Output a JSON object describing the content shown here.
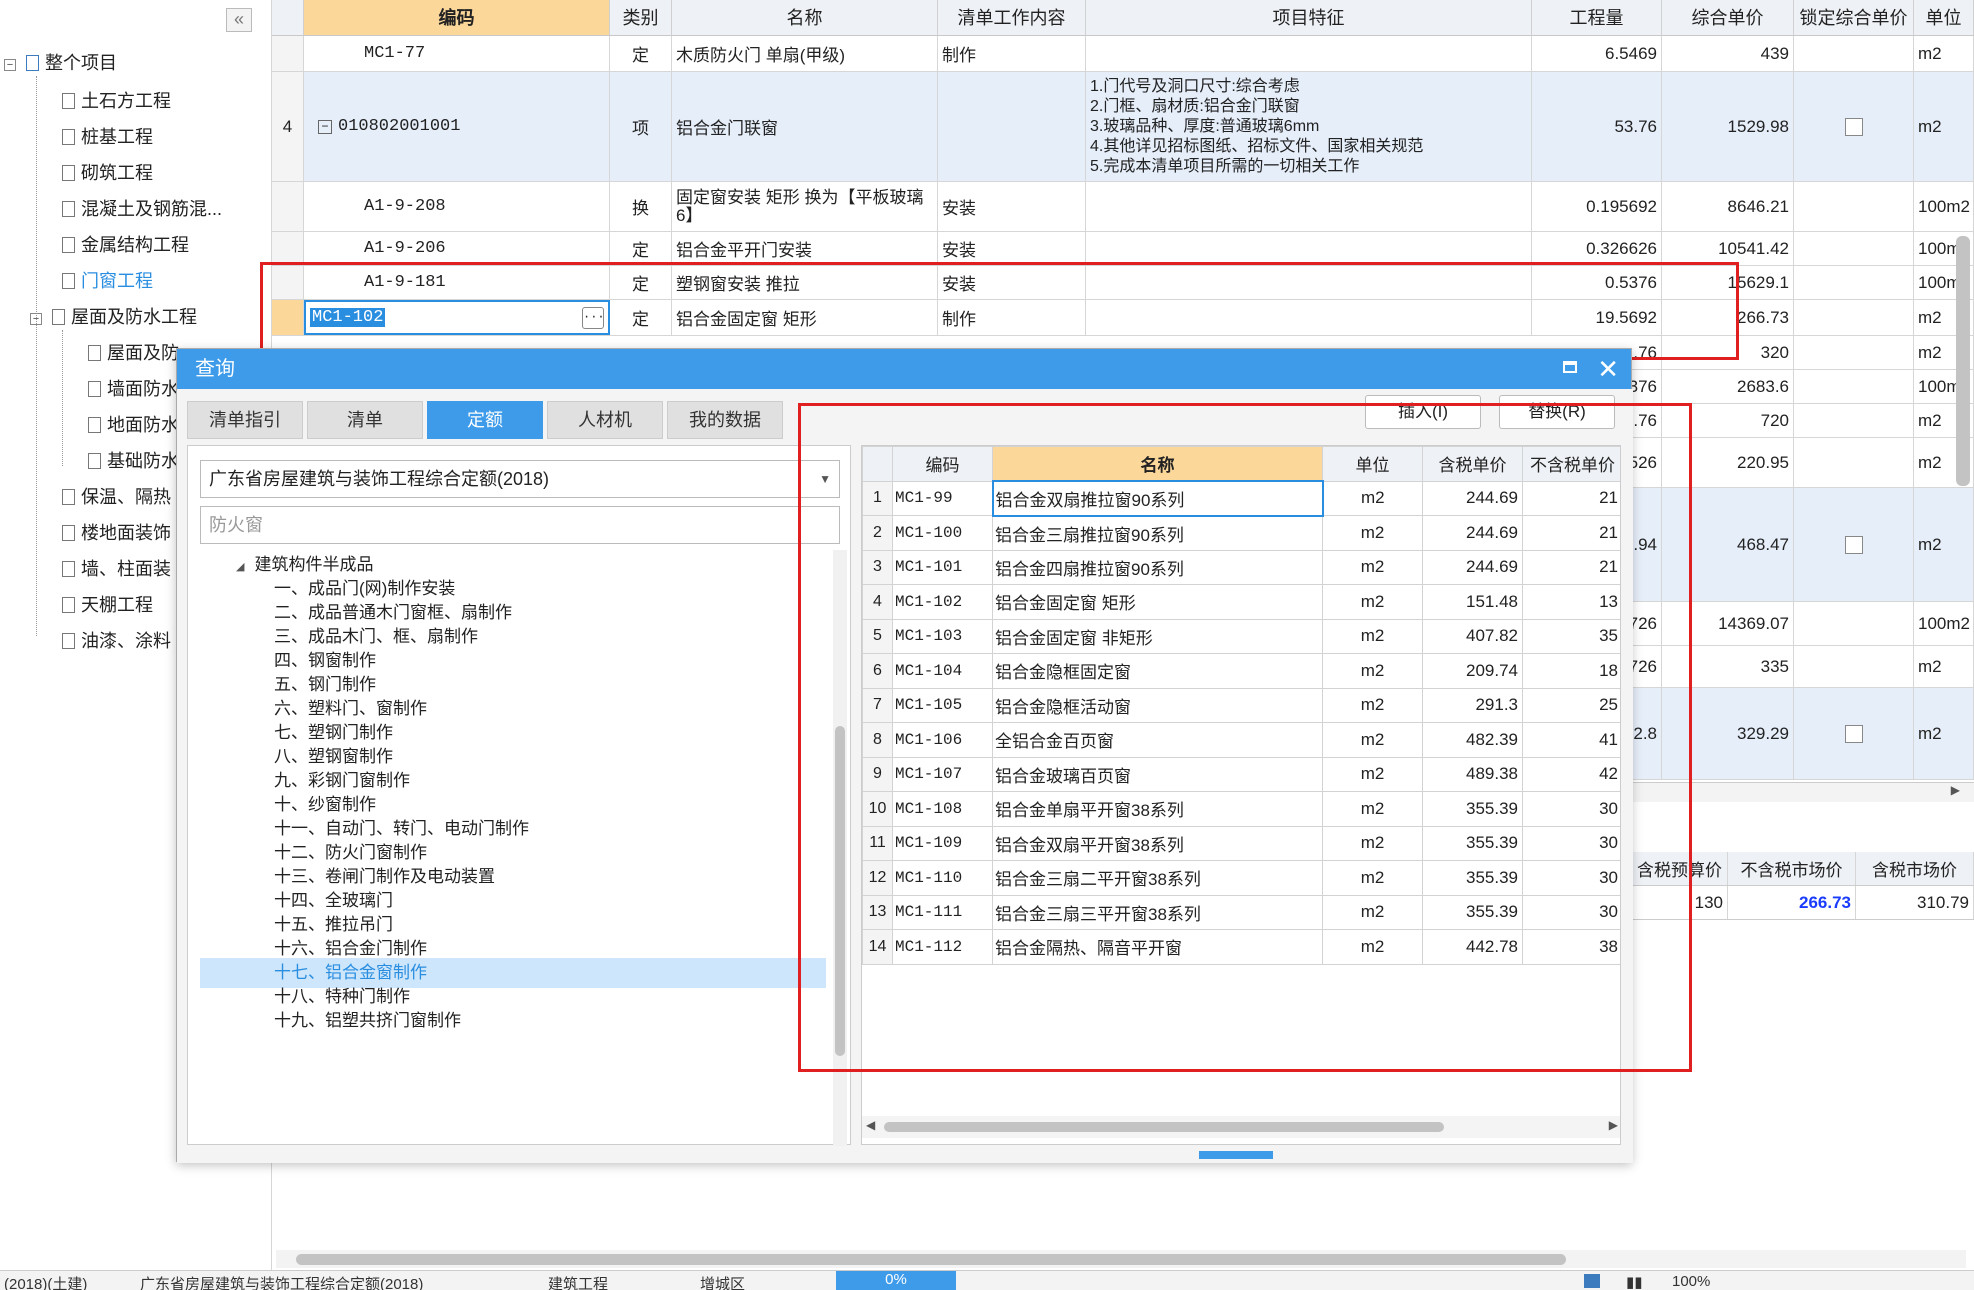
{
  "left_tree": {
    "items": [
      {
        "label": "整个项目"
      },
      {
        "label": "土石方工程"
      },
      {
        "label": "桩基工程"
      },
      {
        "label": "砌筑工程"
      },
      {
        "label": "混凝土及钢筋混..."
      },
      {
        "label": "金属结构工程"
      },
      {
        "label": "门窗工程"
      },
      {
        "label": "屋面及防水工程"
      },
      {
        "label": "屋面及防"
      },
      {
        "label": "墙面防水"
      },
      {
        "label": "地面防水"
      },
      {
        "label": "基础防水"
      },
      {
        "label": "保温、隔热"
      },
      {
        "label": "楼地面装饰"
      },
      {
        "label": "墙、柱面装"
      },
      {
        "label": "天棚工程"
      },
      {
        "label": "油漆、涂料"
      }
    ]
  },
  "grid": {
    "headers": [
      "编码",
      "类别",
      "名称",
      "清单工作内容",
      "项目特征",
      "工程量",
      "综合单价",
      "锁定综合单价",
      "单位"
    ],
    "rows": [
      {
        "no": "",
        "code": "MC1-77",
        "type": "定",
        "name": "木质防火门 单扇(甲级)",
        "work": "制作",
        "feature": "",
        "qty": "6.5469",
        "price": "439",
        "unit": "m2"
      },
      {
        "no": "4",
        "code": "010802001001",
        "type": "项",
        "name": "铝合金门联窗",
        "work": "",
        "feature_lines": [
          "1.门代号及洞口尺寸:综合考虑",
          "2.门框、扇材质:铝合金门联窗",
          "3.玻璃品种、厚度:普通玻璃6mm",
          "4.其他详见招标图纸、招标文件、国家相关规范",
          "5.完成本清单项目所需的一切相关工作"
        ],
        "qty": "53.76",
        "price": "1529.98",
        "unit": "m2"
      },
      {
        "no": "",
        "code": "A1-9-208",
        "type": "换",
        "name": "固定窗安装 矩形  换为【平板玻璃6】",
        "work": "安装",
        "feature": "",
        "qty": "0.195692",
        "price": "8646.21",
        "unit": "100m2"
      },
      {
        "no": "",
        "code": "A1-9-206",
        "type": "定",
        "name": "铝合金平开门安装",
        "work": "安装",
        "feature": "",
        "qty": "0.326626",
        "price": "10541.42",
        "unit": "100m2"
      },
      {
        "no": "",
        "code": "A1-9-181",
        "type": "定",
        "name": "塑钢窗安装 推拉",
        "work": "安装",
        "feature": "",
        "qty": "0.5376",
        "price": "15629.1",
        "unit": "100m2"
      },
      {
        "no": "",
        "code": "MC1-102",
        "type": "定",
        "name": "铝合金固定窗 矩形",
        "work": "制作",
        "feature": "",
        "qty": "19.5692",
        "price": "266.73",
        "unit": "m2"
      }
    ],
    "partial_right_rows": [
      {
        "qty": ".76",
        "price": "320",
        "unit": "m2"
      },
      {
        "qty": ".376",
        "price": "2683.6",
        "unit": "100m2"
      },
      {
        "qty": ".76",
        "price": "720",
        "unit": "m2"
      },
      {
        "qty": ".526",
        "price": "220.95",
        "unit": "m2"
      },
      {
        "qty": ".94",
        "price": "468.47",
        "unit": "m2"
      },
      {
        "qty": ".726",
        "price": "14369.07",
        "unit": "100m2"
      },
      {
        "qty": ".726",
        "price": "335",
        "unit": "m2"
      },
      {
        "qty": "2.8",
        "price": "329.29",
        "unit": "m2"
      }
    ],
    "bottom_headers": [
      "含税预算价",
      "不含税市场价",
      "含税市场价"
    ],
    "bottom_values": [
      "130",
      "266.73",
      "310.79"
    ]
  },
  "status_bar": {
    "items": [
      "(2018)(土建)",
      "广东省房屋建筑与装饰工程综合定额(2018)",
      "建筑工程",
      "增城区",
      "0%",
      "100%"
    ]
  },
  "dialog": {
    "title": "查询",
    "tabs": [
      "清单指引",
      "清单",
      "定额",
      "人材机",
      "我的数据"
    ],
    "active_tab": "定额",
    "library": "广东省房屋建筑与装饰工程综合定额(2018)",
    "search_placeholder": "防火窗",
    "tree_root": "建筑构件半成品",
    "chapters": [
      "一、成品门(网)制作安装",
      "二、成品普通木门窗框、扇制作",
      "三、成品木门、框、扇制作",
      "四、钢窗制作",
      "五、钢门制作",
      "六、塑料门、窗制作",
      "七、塑钢门制作",
      "八、塑钢窗制作",
      "九、彩钢门窗制作",
      "十、纱窗制作",
      "十一、自动门、转门、电动门制作",
      "十二、防火门窗制作",
      "十三、卷闸门制作及电动装置",
      "十四、全玻璃门",
      "十五、推拉吊门",
      "十六、铝合金门制作",
      "十七、铝合金窗制作",
      "十八、特种门制作",
      "十九、铝塑共挤门窗制作"
    ],
    "selected_chapter": "十七、铝合金窗制作",
    "insert_label": "插入(I)",
    "replace_label": "替换(R)",
    "table_headers": [
      "编码",
      "名称",
      "单位",
      "含税单价",
      "不含税单价"
    ],
    "rows": [
      {
        "idx": "1",
        "code": "MC1-99",
        "name": "铝合金双扇推拉窗90系列",
        "unit": "m2",
        "tax_price": "244.69",
        "notax_price": "21"
      },
      {
        "idx": "2",
        "code": "MC1-100",
        "name": "铝合金三扇推拉窗90系列",
        "unit": "m2",
        "tax_price": "244.69",
        "notax_price": "21"
      },
      {
        "idx": "3",
        "code": "MC1-101",
        "name": "铝合金四扇推拉窗90系列",
        "unit": "m2",
        "tax_price": "244.69",
        "notax_price": "21"
      },
      {
        "idx": "4",
        "code": "MC1-102",
        "name": "铝合金固定窗 矩形",
        "unit": "m2",
        "tax_price": "151.48",
        "notax_price": "13"
      },
      {
        "idx": "5",
        "code": "MC1-103",
        "name": "铝合金固定窗 非矩形",
        "unit": "m2",
        "tax_price": "407.82",
        "notax_price": "35"
      },
      {
        "idx": "6",
        "code": "MC1-104",
        "name": "铝合金隐框固定窗",
        "unit": "m2",
        "tax_price": "209.74",
        "notax_price": "18"
      },
      {
        "idx": "7",
        "code": "MC1-105",
        "name": "铝合金隐框活动窗",
        "unit": "m2",
        "tax_price": "291.3",
        "notax_price": "25"
      },
      {
        "idx": "8",
        "code": "MC1-106",
        "name": "全铝合金百页窗",
        "unit": "m2",
        "tax_price": "482.39",
        "notax_price": "41"
      },
      {
        "idx": "9",
        "code": "MC1-107",
        "name": "铝合金玻璃百页窗",
        "unit": "m2",
        "tax_price": "489.38",
        "notax_price": "42"
      },
      {
        "idx": "10",
        "code": "MC1-108",
        "name": "铝合金单扇平开窗38系列",
        "unit": "m2",
        "tax_price": "355.39",
        "notax_price": "30"
      },
      {
        "idx": "11",
        "code": "MC1-109",
        "name": "铝合金双扇平开窗38系列",
        "unit": "m2",
        "tax_price": "355.39",
        "notax_price": "30"
      },
      {
        "idx": "12",
        "code": "MC1-110",
        "name": "铝合金三扇二平开窗38系列",
        "unit": "m2",
        "tax_price": "355.39",
        "notax_price": "30"
      },
      {
        "idx": "13",
        "code": "MC1-111",
        "name": "铝合金三扇三平开窗38系列",
        "unit": "m2",
        "tax_price": "355.39",
        "notax_price": "30"
      },
      {
        "idx": "14",
        "code": "MC1-112",
        "name": "铝合金隔热、隔音平开窗",
        "unit": "m2",
        "tax_price": "442.78",
        "notax_price": "38"
      }
    ]
  },
  "colors": {
    "accent": "#3d9be9",
    "header_highlight": "#fbd79a",
    "row_blue": "#e6eefa",
    "annotation_red": "#e02020",
    "link_blue": "#2a8ee0"
  }
}
